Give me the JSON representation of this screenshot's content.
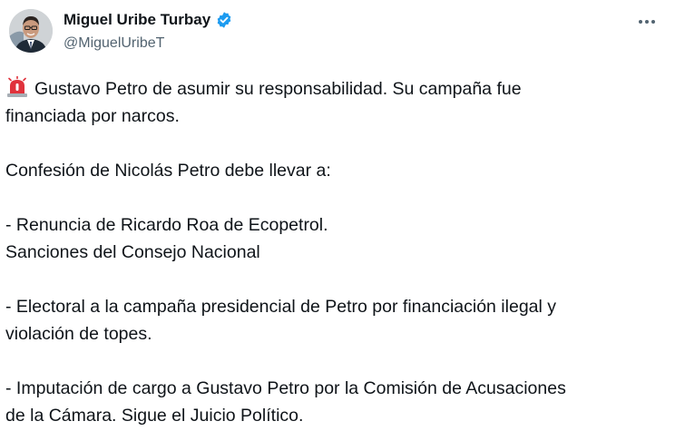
{
  "author": {
    "display_name": "Miguel Uribe Turbay",
    "handle": "@MiguelUribeT",
    "verified": true
  },
  "icons": {
    "verified": "verified-badge-icon",
    "more": "more-options-icon",
    "siren": "rotating-light-emoji"
  },
  "colors": {
    "verified_blue": "#1d9bf0",
    "text_primary": "#0f1419",
    "text_secondary": "#536471",
    "siren_red": "#e0323c"
  },
  "tweet": {
    "lines": [
      "Gustavo Petro de asumir su responsabilidad. Su campaña fue",
      "financiada por narcos.",
      "",
      "Confesión de Nicolás Petro debe llevar a:",
      "",
      "- Renuncia de Ricardo Roa de Ecopetrol.",
      "Sanciones del Consejo Nacional",
      "",
      "- Electoral a la campaña presidencial de Petro por financiación ilegal y",
      "violación de topes.",
      "",
      "- Imputación de cargo a Gustavo Petro por la Comisión de Acusaciones",
      "de la Cámara. Sigue el Juicio Político."
    ]
  }
}
